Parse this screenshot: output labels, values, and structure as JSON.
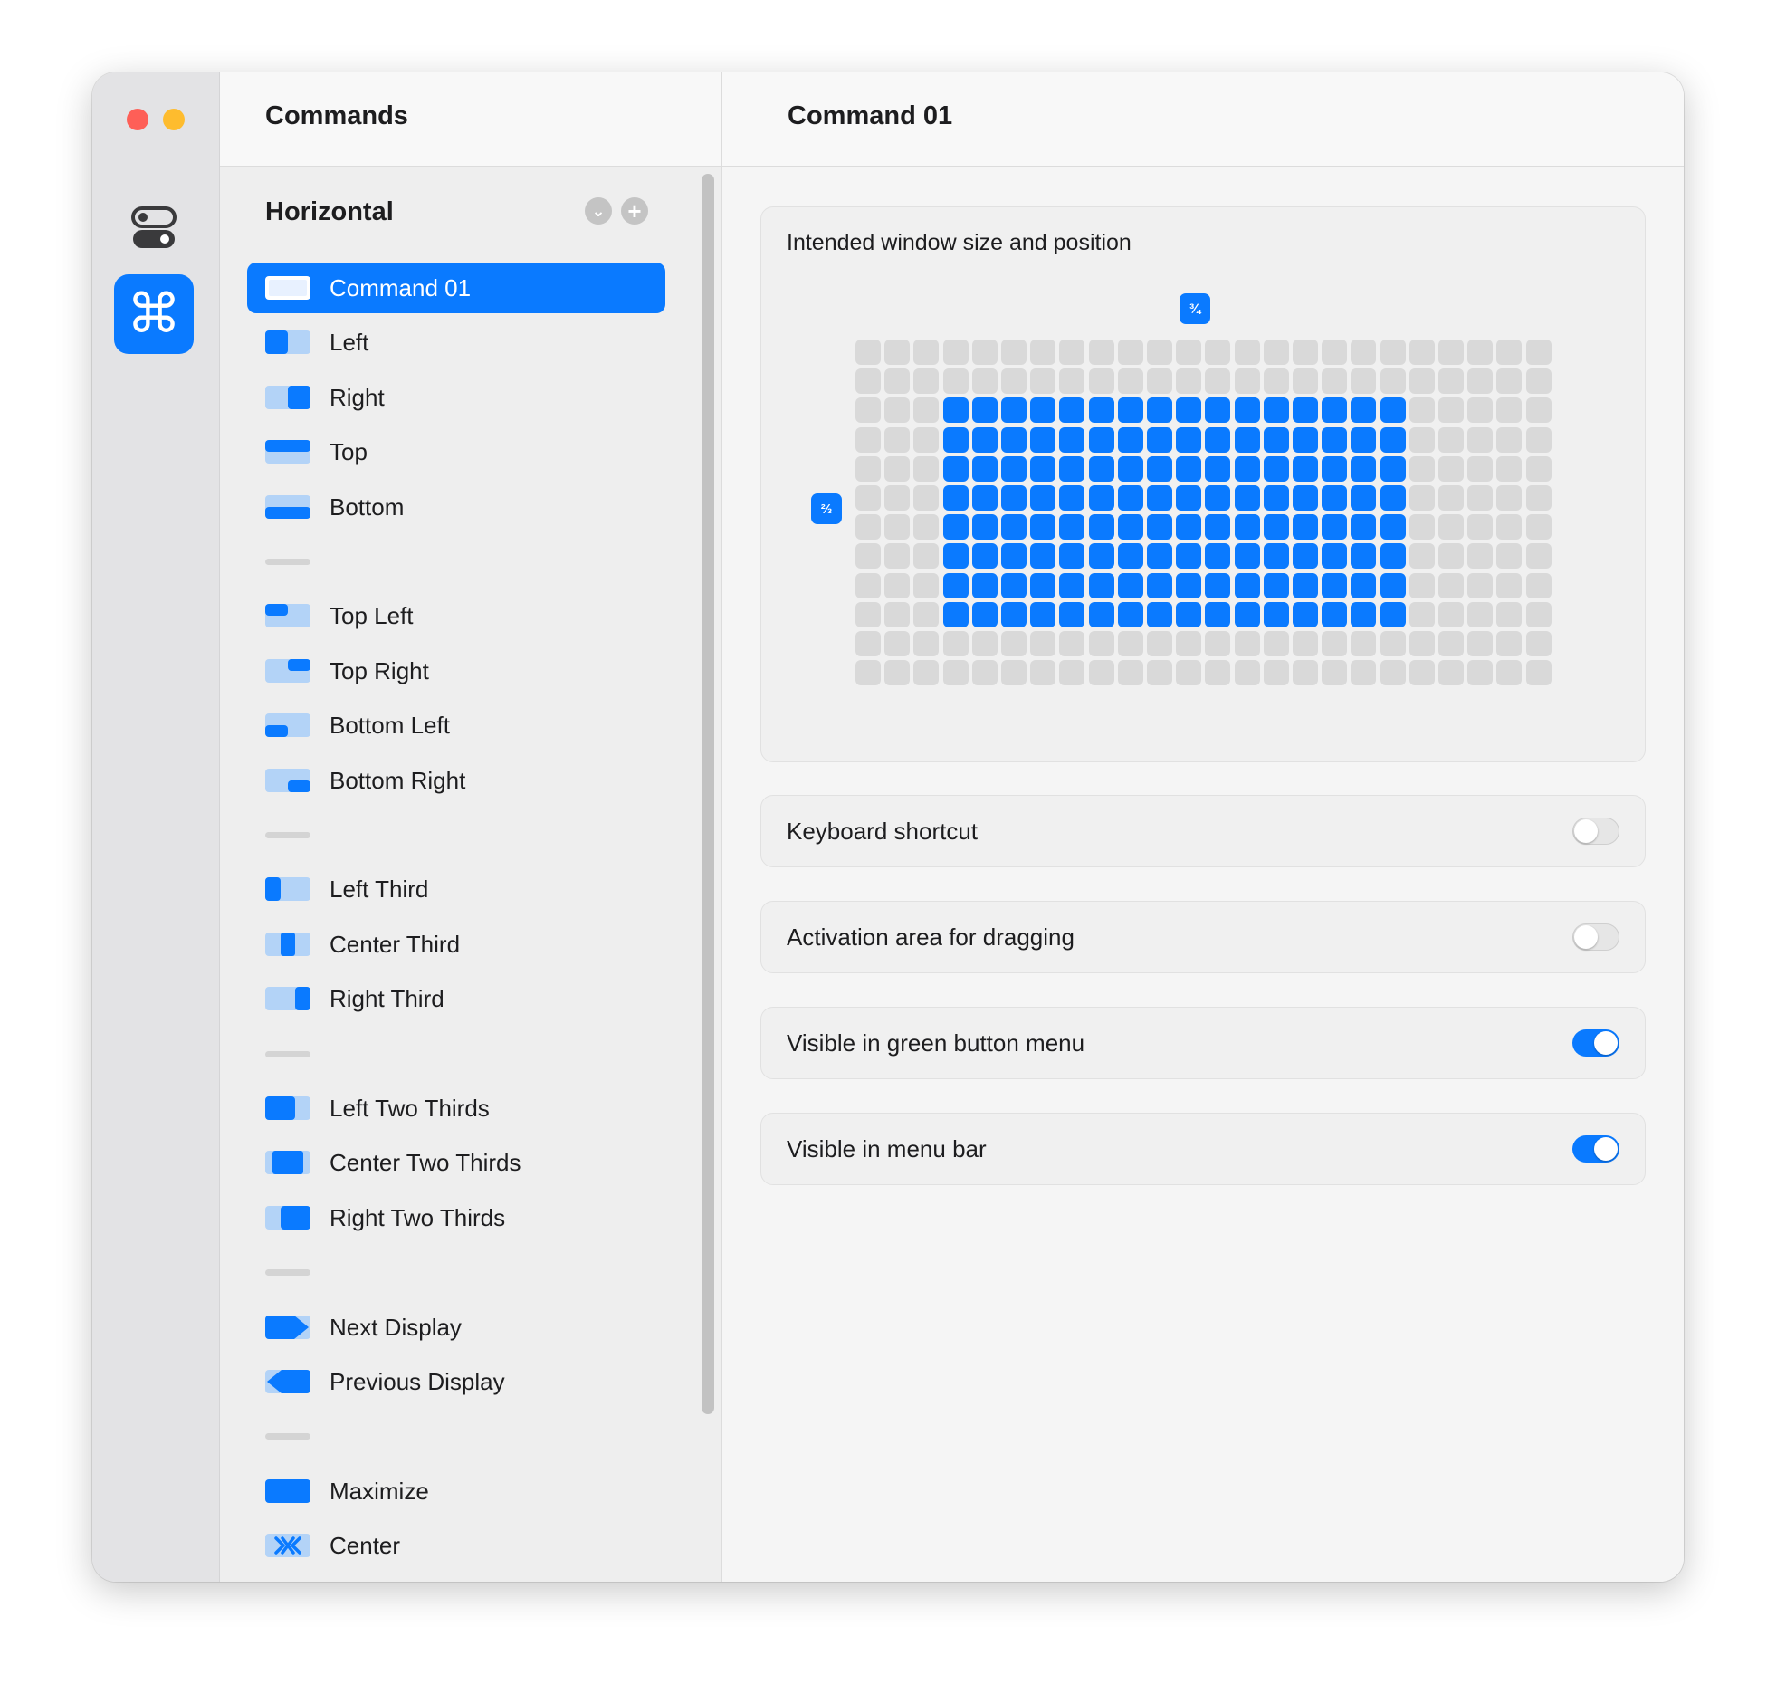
{
  "sidebar_icons": {
    "settings_icon": "toggles-icon",
    "commands_icon": "⌘"
  },
  "list": {
    "header_title": "Commands",
    "group_title": "Horizontal",
    "chevron_icon": "⌄",
    "add_icon": "+",
    "items": [
      {
        "label": "Command 01",
        "icon": "window-full-icon",
        "selected": true
      },
      {
        "label": "Left",
        "icon": "layout-left-icon"
      },
      {
        "label": "Right",
        "icon": "layout-right-icon"
      },
      {
        "label": "Top",
        "icon": "layout-top-icon"
      },
      {
        "label": "Bottom",
        "icon": "layout-bottom-icon"
      },
      {
        "label": "Top Left",
        "icon": "layout-top-left-icon"
      },
      {
        "label": "Top Right",
        "icon": "layout-top-right-icon"
      },
      {
        "label": "Bottom Left",
        "icon": "layout-bottom-left-icon"
      },
      {
        "label": "Bottom Right",
        "icon": "layout-bottom-right-icon"
      },
      {
        "label": "Left Third",
        "icon": "layout-left-third-icon"
      },
      {
        "label": "Center Third",
        "icon": "layout-center-third-icon"
      },
      {
        "label": "Right Third",
        "icon": "layout-right-third-icon"
      },
      {
        "label": "Left Two Thirds",
        "icon": "layout-left-two-thirds-icon"
      },
      {
        "label": "Center Two Thirds",
        "icon": "layout-center-two-thirds-icon"
      },
      {
        "label": "Right Two Thirds",
        "icon": "layout-right-two-thirds-icon"
      },
      {
        "label": "Next Display",
        "icon": "next-display-icon"
      },
      {
        "label": "Previous Display",
        "icon": "previous-display-icon"
      },
      {
        "label": "Maximize",
        "icon": "maximize-icon"
      },
      {
        "label": "Center",
        "icon": "center-icon"
      }
    ]
  },
  "detail": {
    "header_title": "Command 01",
    "grid_card": {
      "title": "Intended window size and position",
      "width_fraction": "¾",
      "height_fraction": "⅔",
      "grid_columns": 24,
      "grid_rows": 12,
      "selected_columns": [
        3,
        18
      ],
      "selected_rows": [
        2,
        9
      ]
    },
    "settings": [
      {
        "label": "Keyboard shortcut",
        "on": false
      },
      {
        "label": "Activation area for dragging",
        "on": false
      },
      {
        "label": "Visible in green button menu",
        "on": true
      },
      {
        "label": "Visible in menu bar",
        "on": true
      }
    ]
  },
  "colors": {
    "accent": "#0a7aff",
    "accent_light": "#b3d3f7",
    "cell_off": "#d9d9d9",
    "close": "#fe5f57",
    "minimize": "#febc2e"
  }
}
